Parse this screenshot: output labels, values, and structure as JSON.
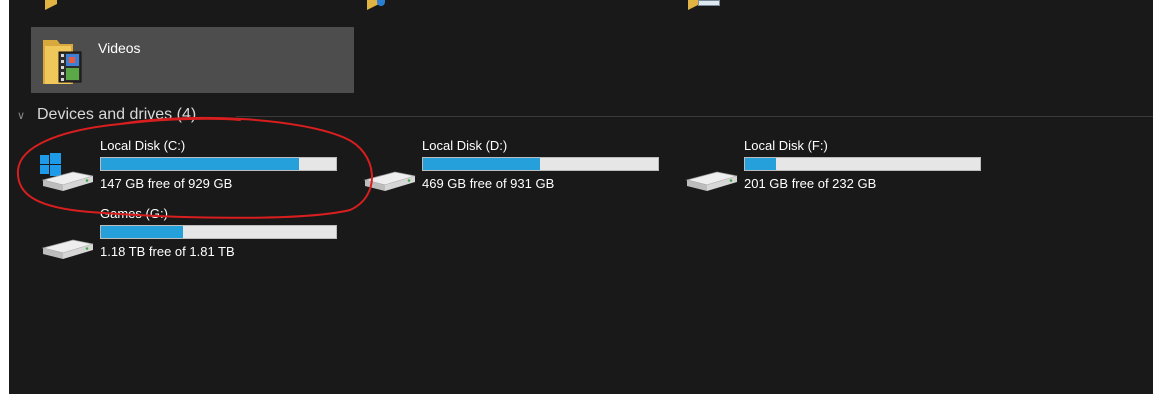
{
  "window": {
    "background": "#191919",
    "accent": "#26a0da",
    "annotation_color": "#d81e1e"
  },
  "folders": {
    "videos": {
      "label": "Videos",
      "icon": "videos-folder-icon"
    }
  },
  "devices": {
    "header": "Devices and drives (4)",
    "drives": [
      {
        "label": "Local Disk (C:)",
        "free_text": "147 GB free of 929 GB",
        "used_fraction": 0.842,
        "icon": "windows-drive-icon"
      },
      {
        "label": "Local Disk (D:)",
        "free_text": "469 GB free of 931 GB",
        "used_fraction": 0.496,
        "icon": "hard-drive-icon"
      },
      {
        "label": "Local Disk (F:)",
        "free_text": "201 GB free of 232 GB",
        "used_fraction": 0.134,
        "icon": "hard-drive-icon"
      },
      {
        "label": "Games (G:)",
        "free_text": "1.18 TB free of 1.81 TB",
        "used_fraction": 0.348,
        "icon": "hard-drive-icon"
      }
    ]
  }
}
